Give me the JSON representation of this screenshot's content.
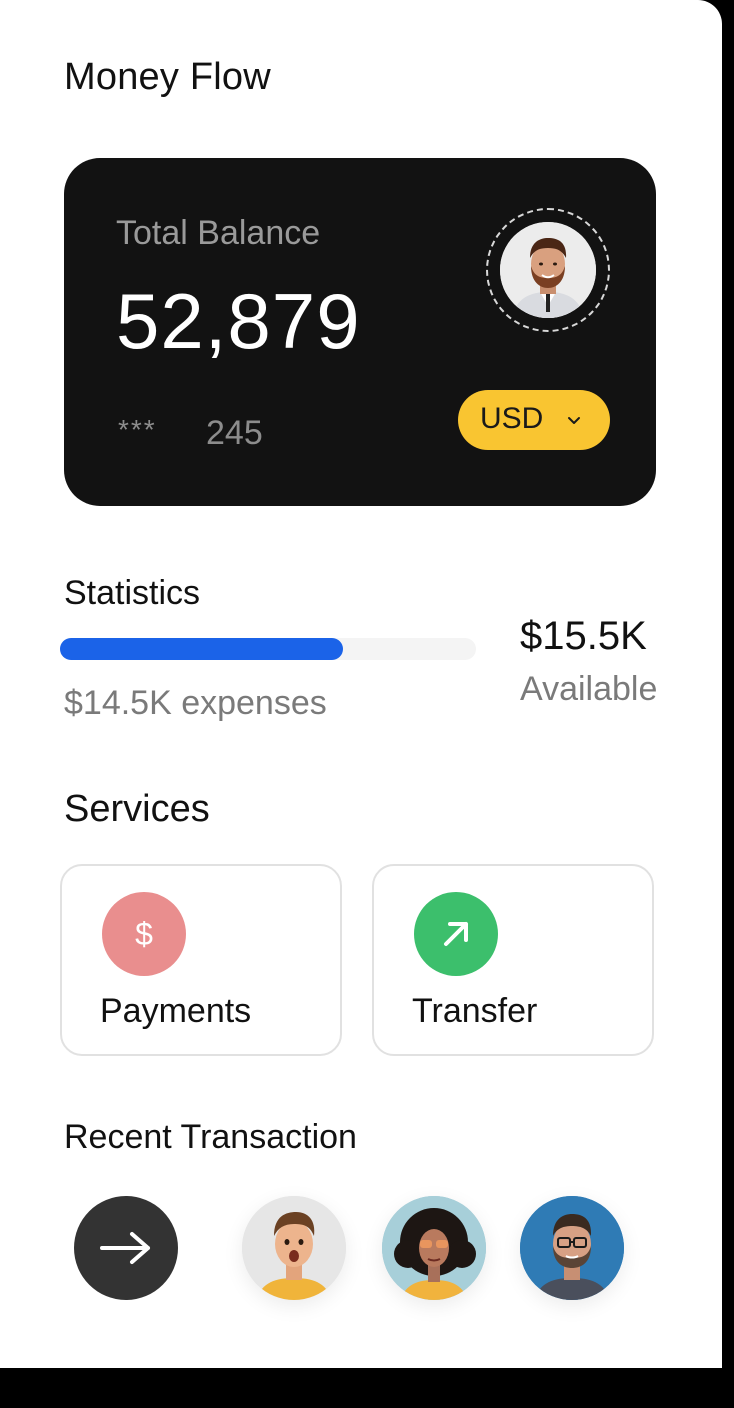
{
  "app": {
    "title": "Money Flow"
  },
  "balance_card": {
    "label": "Total Balance",
    "amount": "52,879",
    "card_mask": "***",
    "card_last_digits": "245",
    "currency": "USD",
    "avatar_icon": "user-avatar"
  },
  "statistics": {
    "title": "Statistics",
    "expenses_text": "$14.5K expenses",
    "available_amount": "$15.5K",
    "available_label": "Available",
    "spent_fraction": 0.68,
    "bar_color": "#1b63e8"
  },
  "services": {
    "title": "Services",
    "items": [
      {
        "label": "Payments",
        "icon": "dollar-icon",
        "color": "#e98e8e"
      },
      {
        "label": "Transfer",
        "icon": "arrow-up-right-icon",
        "color": "#3cbf6c"
      }
    ]
  },
  "recent": {
    "title": "Recent Transaction",
    "see_all_icon": "arrow-right-icon",
    "contacts": [
      {
        "avatar": "contact-avatar-1"
      },
      {
        "avatar": "contact-avatar-2"
      },
      {
        "avatar": "contact-avatar-3"
      }
    ]
  },
  "colors": {
    "card_background": "#121212",
    "currency_accent": "#f9c531",
    "progress_fill": "#1b63e8"
  }
}
